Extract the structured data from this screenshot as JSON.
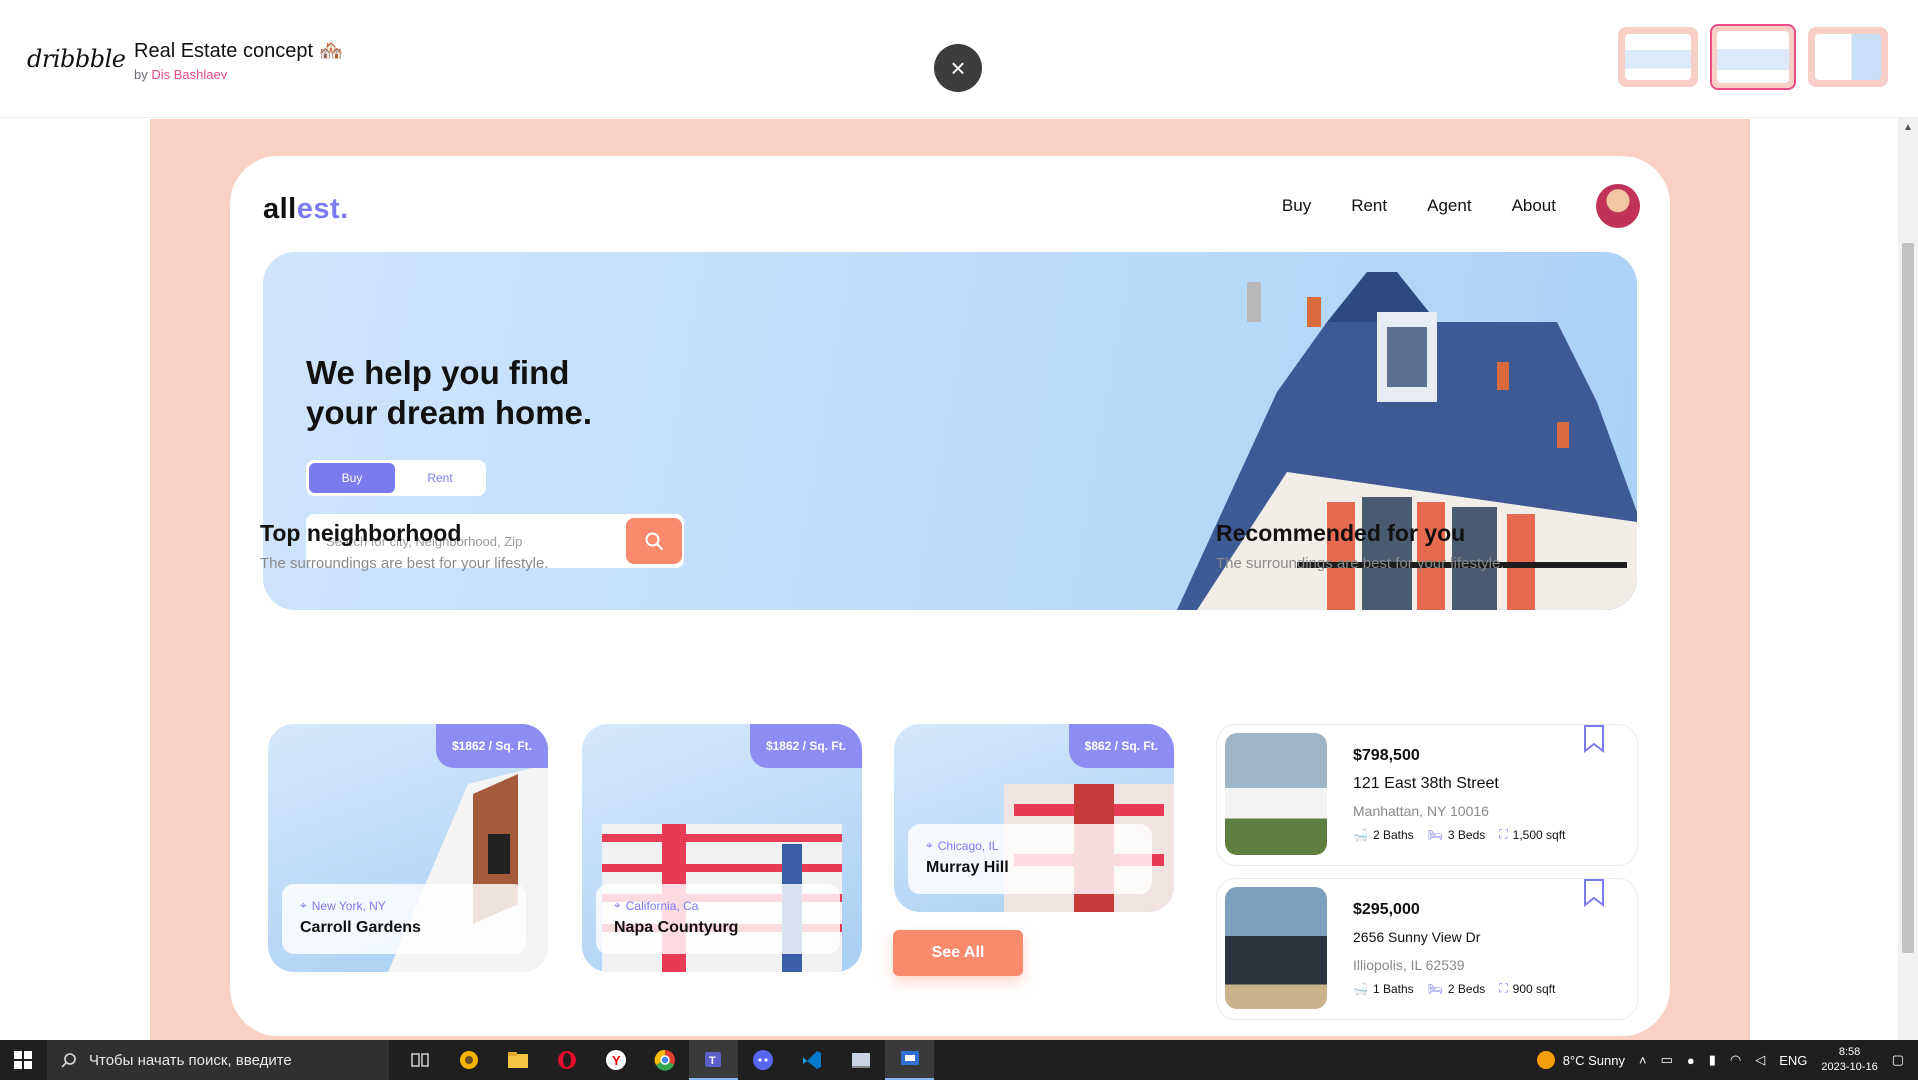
{
  "topbar": {
    "logo": "dribbble",
    "title": "Real Estate concept 🏘️",
    "by": "by",
    "author": "Dis Bashlaev",
    "close_icon": "×",
    "thumbnails": 3
  },
  "site": {
    "brand_main": "all",
    "brand_accent": "est.",
    "nav": [
      "Buy",
      "Rent",
      "Agent",
      "About"
    ],
    "hero": {
      "title": "We help you find your dream home.",
      "toggle": [
        "Buy",
        "Rent"
      ],
      "search_placeholder": "Search for city, Neighborhood, Zip"
    },
    "top": {
      "title": "Top neighborhood",
      "subtitle": "The surroundings are best for your lifestyle.",
      "cards": [
        {
          "price": "$1862 / Sq. Ft.",
          "city": "New York, NY",
          "name": "Carroll Gardens"
        },
        {
          "price": "$1862 / Sq. Ft.",
          "city": "California, Ca",
          "name": "Napa Countyurg"
        },
        {
          "price": "$862 / Sq. Ft.",
          "city": "Chicago, IL",
          "name": "Murray Hill"
        }
      ],
      "see_all": "See All"
    },
    "recommended": {
      "title": "Recommended for you",
      "subtitle": "The surroundings are best for your lifestyle.",
      "items": [
        {
          "price": "$798,500",
          "address": "121 East 38th Street",
          "city": "Manhattan, NY 10016",
          "baths": "2 Baths",
          "beds": "3 Beds",
          "area": "1,500 sqft"
        },
        {
          "price": "$295,000",
          "address": "2656 Sunny View Dr",
          "city": "Illiopolis, IL 62539",
          "baths": "1 Baths",
          "beds": "2 Beds",
          "area": "900 sqft"
        }
      ]
    },
    "colors": {
      "accent": "#7b7bf0",
      "cta": "#fa8a6d",
      "backdrop": "#f9d0c4"
    }
  },
  "taskbar": {
    "search_placeholder": "Чтобы начать поиск, введите",
    "weather": "8°C  Sunny",
    "lang": "ENG",
    "time": "8:58",
    "date": "2023-10-16",
    "apps": [
      "task-view-icon",
      "yandex-browser-icon",
      "file-explorer-icon",
      "opera-icon",
      "yandex-icon",
      "chrome-icon",
      "teams-icon",
      "discord-icon",
      "vscode-icon",
      "app-icon",
      "remote-icon"
    ]
  }
}
